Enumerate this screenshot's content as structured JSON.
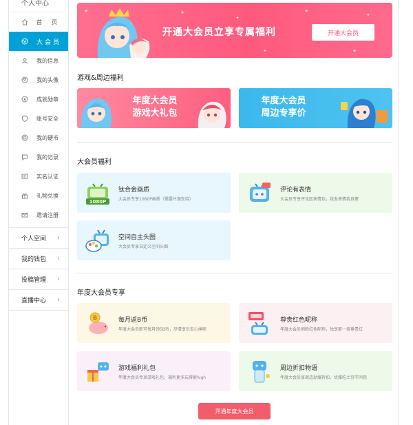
{
  "sidebar": {
    "title": "个人中心",
    "items": [
      {
        "label": "首页",
        "icon": "home-icon"
      },
      {
        "label": "大会员",
        "icon": "vip-icon"
      },
      {
        "label": "我的信息",
        "icon": "user-info-icon"
      },
      {
        "label": "我的头像",
        "icon": "avatar-icon"
      },
      {
        "label": "成就勋章",
        "icon": "medal-icon"
      },
      {
        "label": "账号安全",
        "icon": "shield-icon"
      },
      {
        "label": "我的硬币",
        "icon": "coin-icon"
      },
      {
        "label": "我的记录",
        "icon": "record-icon"
      },
      {
        "label": "实名认证",
        "icon": "id-card-icon"
      },
      {
        "label": "礼物兑换",
        "icon": "gift-icon"
      },
      {
        "label": "邀请注册",
        "icon": "invite-icon"
      }
    ],
    "groups": [
      {
        "label": "个人空间"
      },
      {
        "label": "我的钱包"
      },
      {
        "label": "投稿管理"
      },
      {
        "label": "直播中心"
      }
    ]
  },
  "banner": {
    "title": "开通大会员立享专属福利",
    "button": "开通大会员"
  },
  "sections": {
    "games": "游戏&周边福利",
    "vip_benefits": "大会员福利",
    "annual": "年度大会员专享"
  },
  "promos": [
    {
      "line1": "年度大会员",
      "line2": "游戏大礼包"
    },
    {
      "line1": "年度大会员",
      "line2": "周边专享价"
    }
  ],
  "vip_cards": [
    {
      "title": "钛合金画质",
      "desc": "大会员专享1080P画质（需要片源支持）",
      "icon": "tv-1080p-icon",
      "bg": "#e8f6fd"
    },
    {
      "title": "评论有表情",
      "desc": "大会员专享评论区表情包，我发表情我自豪",
      "icon": "emoji-tv-icon",
      "bg": "#edf9e9"
    },
    {
      "title": "空间自主头图",
      "desc": "大会员专享自定义空间头图",
      "icon": "palette-tv-icon",
      "bg": "#e8f6fd"
    }
  ],
  "annual_cards": [
    {
      "title": "每月返B币",
      "desc": "年度大会员即可每月领5B币，尽情享乐安心捶呢",
      "icon": "piggy-bank-icon",
      "bg": "#fdf7e6"
    },
    {
      "title": "尊贵红色昵称",
      "desc": "年度大会员刷粉红色昵称，独享那一抹尊贵红",
      "icon": "red-name-icon",
      "bg": "#fdf0f2"
    },
    {
      "title": "游戏福利礼包",
      "desc": "年度大会员专享游戏礼包，福利更多玩得更high",
      "icon": "game-gift-icon",
      "bg": "#fbf0fa"
    },
    {
      "title": "周边折扣物语",
      "desc": "年度大会员享周边劲爆折扣，优雅吃土穷不同怨",
      "icon": "merch-icon",
      "bg": "#edf9e9"
    }
  ],
  "bottom_button": "开通年度大会员",
  "colors": {
    "active": "#00a1d6",
    "banner": "#ff5a7e",
    "button_red": "#f25d6b",
    "promo_pink": "#ff6b86",
    "promo_blue": "#3bb8ec"
  }
}
